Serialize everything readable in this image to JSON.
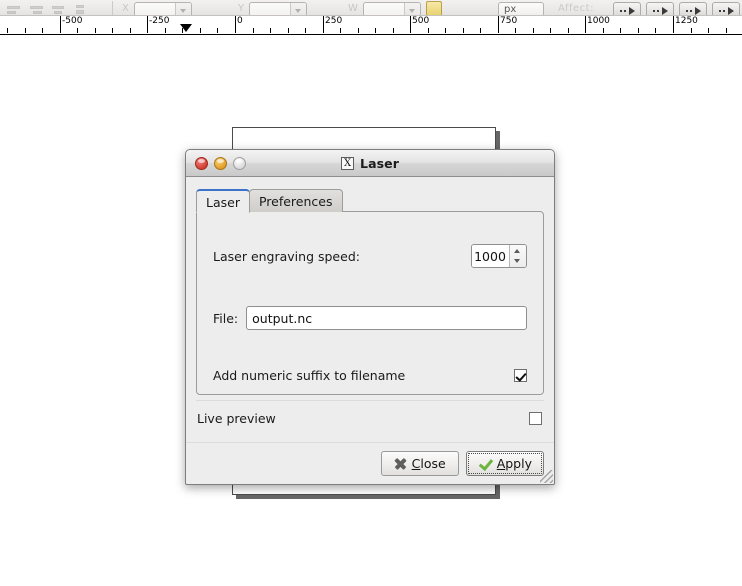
{
  "toolbar": {
    "align_icons": [
      "align-left-icon",
      "align-center-icon",
      "align-right-icon",
      "align-justify-icon"
    ],
    "x_field_value": "",
    "y_field_value": "",
    "w_field_value": "",
    "unit_value": "px",
    "lock_icon": "lock-icon",
    "plus_label": "+",
    "affect_label": "Affect:",
    "arrow_buttons": [
      "move-arrow-1",
      "move-arrow-2",
      "move-arrow-3",
      "move-arrow-4"
    ]
  },
  "ruler": {
    "unit_labels": [
      "-500",
      "-250",
      "0",
      "250",
      "500",
      "750",
      "1000",
      "1250"
    ],
    "marker_name": "ruler-guide-marker"
  },
  "dialog": {
    "title": "Laser",
    "icon": "x-app-icon",
    "window_buttons": {
      "close": "close-window-button",
      "minimize": "minimize-window-button",
      "maximize": "maximize-window-button"
    },
    "tabs": [
      {
        "label": "Laser",
        "active": true
      },
      {
        "label": "Preferences",
        "active": false
      }
    ],
    "fields": {
      "speed_label": "Laser engraving speed:",
      "speed_value": "1000",
      "file_label": "File:",
      "file_value": "output.nc",
      "file_placeholder": "output.nc",
      "suffix_label": "Add numeric suffix to filename",
      "suffix_checked": true
    },
    "live_preview": {
      "label": "Live preview",
      "checked": false
    },
    "actions": {
      "close": {
        "label_before": "",
        "accel": "C",
        "label_after": "lose",
        "icon": "x-mark-icon"
      },
      "apply": {
        "label_before": "",
        "accel": "A",
        "label_after": "pply",
        "icon": "green-check-icon"
      }
    }
  }
}
